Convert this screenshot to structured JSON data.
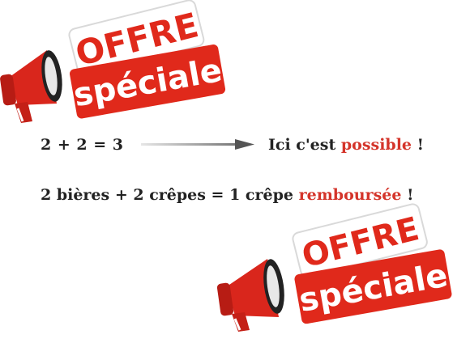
{
  "promo_badge": {
    "line1": "OFFRE",
    "line2": "spéciale"
  },
  "statements": {
    "equation_1": "2 + 2 = 3",
    "claim_prefix": "Ici c'est ",
    "claim_highlight": "possible",
    "claim_suffix": " !",
    "equation_2_prefix": "2 bières + 2 crêpes = 1 crêpe ",
    "equation_2_highlight": "remboursée",
    "equation_2_suffix": " !"
  },
  "colors": {
    "accent_red": "#d4342a",
    "badge_red": "#e0291b",
    "text_dark": "#222222",
    "arrow_gray": "#777777"
  },
  "icons": [
    "megaphone-icon",
    "arrow-right-icon"
  ]
}
